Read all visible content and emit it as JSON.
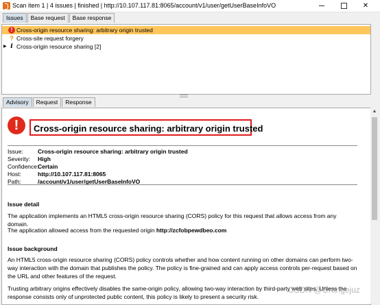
{
  "window": {
    "title": "Scan item 1 | 4 issues | finished | http://10.107.117.81:8065/account/v1/user/getUserBaseInfoVO",
    "min_glyph": "",
    "max_glyph": "",
    "close_glyph": "✕"
  },
  "top_tabs": [
    {
      "label": "Issues",
      "active": true
    },
    {
      "label": "Base request",
      "active": false
    },
    {
      "label": "Base response",
      "active": false
    }
  ],
  "issues": [
    {
      "icon": "high-severity",
      "glyph": "!",
      "label": "Cross-origin resource sharing: arbitrary origin trusted",
      "selected": true,
      "expander": ""
    },
    {
      "icon": "tentative",
      "glyph": "?",
      "label": "Cross-site request forgery",
      "selected": false,
      "expander": ""
    },
    {
      "icon": "info",
      "glyph": "i",
      "label": "Cross-origin resource sharing [2]",
      "selected": false,
      "expander": "▶"
    }
  ],
  "bottom_tabs": [
    {
      "label": "Advisory",
      "active": true
    },
    {
      "label": "Request",
      "active": false
    },
    {
      "label": "Response",
      "active": false
    }
  ],
  "advisory": {
    "icon_glyph": "!",
    "title": "Cross-origin resource sharing: arbitrary origin trusted",
    "meta": {
      "issue_label": "Issue:",
      "issue_value": "Cross-origin resource sharing: arbitrary origin trusted",
      "severity_label": "Severity:",
      "severity_value": "High",
      "confidence_label": "Confidence:",
      "confidence_value": "Certain",
      "host_label": "Host:",
      "host_value": "http://10.107.117.81:8065",
      "path_label": "Path:",
      "path_value": "/account/v1/user/getUserBaseInfoVO"
    },
    "issue_detail_heading": "Issue detail",
    "issue_detail_p1": "The application implements an HTML5 cross-origin resource sharing (CORS) policy for this request that allows access from any domain.",
    "issue_detail_p2_prefix": "The application allowed access from the requested origin ",
    "issue_detail_p2_origin": "http://zcfobpewdbeo.com",
    "issue_background_heading": "Issue background",
    "issue_background_p1": "An HTML5 cross-origin resource sharing (CORS) policy controls whether and how content running on other domains can perform two-way interaction with the domain that publishes the policy. The policy is fine-grained and can apply access controls per-request based on the URL and other features of the request.",
    "issue_background_p2": "Trusting arbitrary origins effectively disables the same-origin policy, allowing two-way interaction by third-party web sites. Unless the response consists only of unprotected public content, this policy is likely to present a security risk."
  },
  "scrollbar": {
    "up_glyph": "▲"
  },
  "watermark": "CSDN @Orangejuz"
}
